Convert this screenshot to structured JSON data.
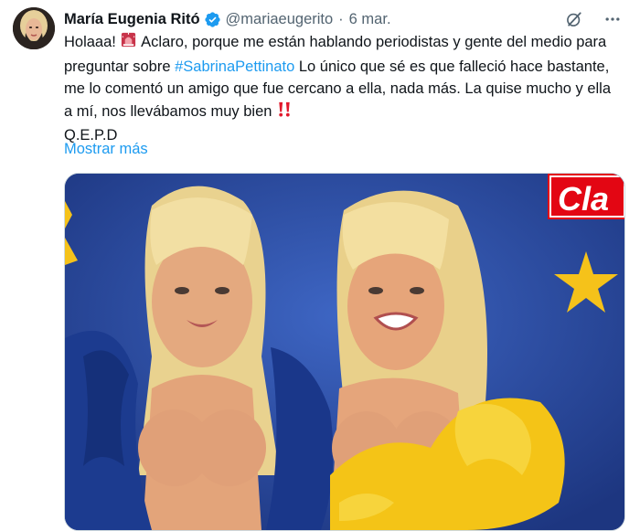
{
  "tweet": {
    "author_name": "María Eugenia Ritó",
    "handle": "@mariaeugerito",
    "separator": "·",
    "date": "6 mar.",
    "text_segments": {
      "intro": "Holaaa!",
      "part1": "Aclaro, porque me están hablando periodistas y gente del medio para preguntar sobre",
      "hashtag": "#SabrinaPettinato",
      "part2": "Lo único que sé es que falleció hace bastante, me lo comentó un amigo que fue cercano a ella, nada más. La quise mucho y ella a mí, nos llevábamos muy bien",
      "sign_off": "Q.E.P.D"
    },
    "show_more": "Mostrar más"
  },
  "icons": {
    "verified": "verified-badge-icon",
    "grok": "grok-icon",
    "more": "more-icon",
    "siren": "siren-emoji-icon",
    "exclamation": "double-exclamation-emoji-icon"
  },
  "media": {
    "logo_text": "Cla"
  },
  "colors": {
    "link": "#1d9bf0",
    "secondary_text": "#536471",
    "primary_text": "#0f1419",
    "image_background": "#23418f",
    "logo_red": "#e30613"
  }
}
